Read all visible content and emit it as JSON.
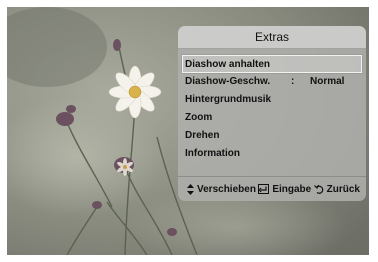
{
  "panel": {
    "title": "Extras",
    "items": [
      {
        "label": "Diashow anhalten",
        "selected": true
      },
      {
        "label": "Diashow-Geschw.",
        "separator": ":",
        "value": "Normal"
      },
      {
        "label": "Hintergrundmusik"
      },
      {
        "label": "Zoom"
      },
      {
        "label": "Drehen"
      },
      {
        "label": "Information"
      }
    ]
  },
  "footer": {
    "move": {
      "icon": "up-down-arrows-icon",
      "label": "Verschieben"
    },
    "enter": {
      "icon": "enter-icon",
      "label": "Eingabe"
    },
    "back": {
      "icon": "return-icon",
      "label": "Zurück"
    }
  },
  "colors": {
    "panel_background": "#b0b0ad",
    "text": "#111111",
    "highlight_border": "#f2f2f2"
  }
}
